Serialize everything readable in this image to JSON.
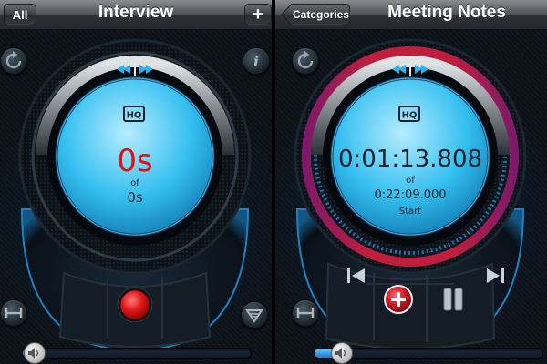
{
  "left_screen": {
    "nav": {
      "all_label": "All",
      "title": "Interview",
      "add_label": "+"
    },
    "display": {
      "badge": "HQ",
      "elapsed": "0s",
      "of_label": "of",
      "total": "0s"
    },
    "volume_level": 0.05,
    "colors": {
      "elapsed": "#e01010",
      "lcd": "#20b8ea",
      "record": "#d81818"
    }
  },
  "right_screen": {
    "nav": {
      "back_label": "Categories",
      "title": "Meeting Notes"
    },
    "display": {
      "badge": "HQ",
      "elapsed": "0:01:13.808",
      "of_label": "of",
      "total": "0:22:09.000",
      "position_label": "Start"
    },
    "volume_level": 0.12,
    "colors": {
      "lcd": "#20b8ea",
      "add_bookmark": "#c81020"
    }
  }
}
